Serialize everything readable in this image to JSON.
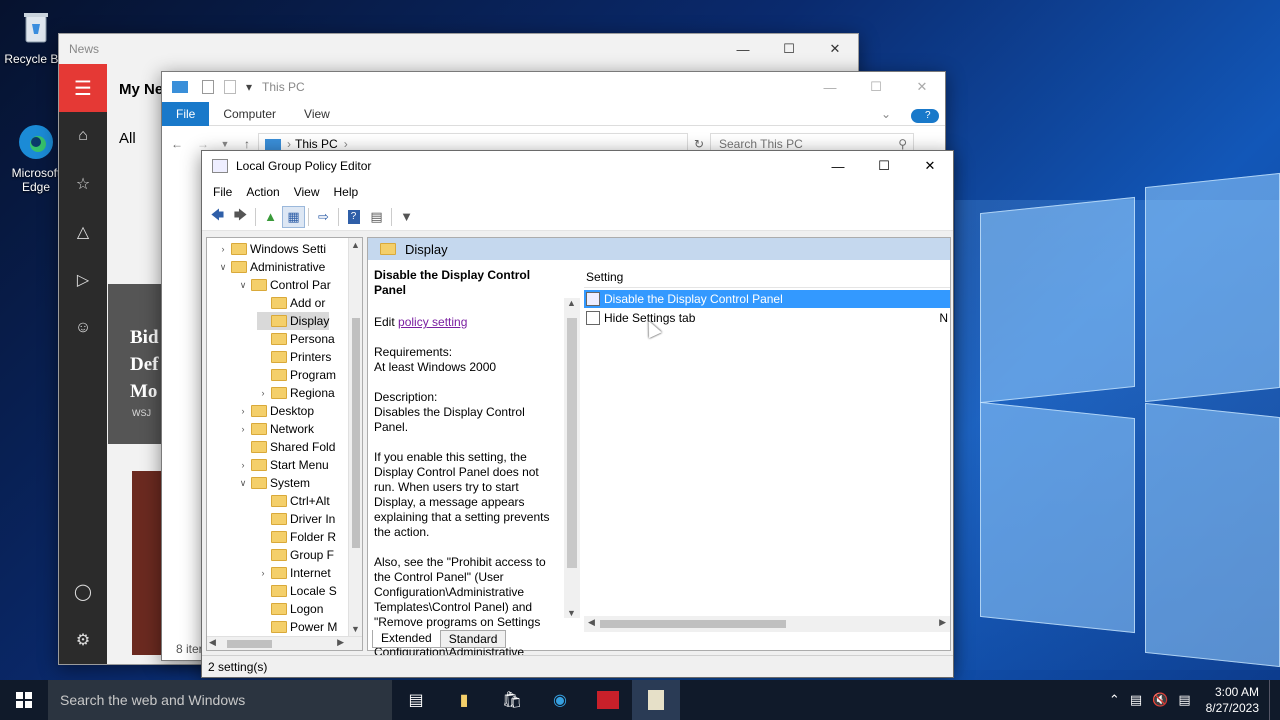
{
  "desktop": {
    "icons": [
      {
        "label": "Recycle Bin"
      },
      {
        "label": "Microsoft Edge"
      }
    ]
  },
  "news": {
    "title": "News",
    "heading": "My Ne",
    "tab_all": "All",
    "headline": "Bid Def Mo",
    "source": "WSJ",
    "items_count": "8 iter"
  },
  "explorer": {
    "title": "This PC",
    "tabs": [
      "File",
      "Computer",
      "View"
    ],
    "address": "This PC",
    "search_placeholder": "Search This PC"
  },
  "gpe": {
    "title": "Local Group Policy Editor",
    "menu": [
      "File",
      "Action",
      "View",
      "Help"
    ],
    "tree": [
      {
        "label": "Windows Setti",
        "level": 1,
        "expander": "collapsed"
      },
      {
        "label": "Administrative",
        "level": 1,
        "expander": "expanded"
      },
      {
        "label": "Control Par",
        "level": 2,
        "expander": "expanded"
      },
      {
        "label": "Add or",
        "level": 3,
        "expander": "none"
      },
      {
        "label": "Display",
        "level": 3,
        "expander": "none",
        "selected": true
      },
      {
        "label": "Persona",
        "level": 3,
        "expander": "none"
      },
      {
        "label": "Printers",
        "level": 3,
        "expander": "none"
      },
      {
        "label": "Program",
        "level": 3,
        "expander": "none"
      },
      {
        "label": "Regiona",
        "level": 3,
        "expander": "collapsed"
      },
      {
        "label": "Desktop",
        "level": 2,
        "expander": "collapsed"
      },
      {
        "label": "Network",
        "level": 2,
        "expander": "collapsed"
      },
      {
        "label": "Shared Fold",
        "level": 2,
        "expander": "none"
      },
      {
        "label": "Start Menu",
        "level": 2,
        "expander": "collapsed"
      },
      {
        "label": "System",
        "level": 2,
        "expander": "expanded"
      },
      {
        "label": "Ctrl+Alt",
        "level": 3,
        "expander": "none"
      },
      {
        "label": "Driver In",
        "level": 3,
        "expander": "none"
      },
      {
        "label": "Folder R",
        "level": 3,
        "expander": "none"
      },
      {
        "label": "Group F",
        "level": 3,
        "expander": "none"
      },
      {
        "label": "Internet",
        "level": 3,
        "expander": "collapsed"
      },
      {
        "label": "Locale S",
        "level": 3,
        "expander": "none"
      },
      {
        "label": "Logon",
        "level": 3,
        "expander": "none"
      },
      {
        "label": "Power M",
        "level": 3,
        "expander": "none"
      }
    ],
    "pane_header": "Display",
    "description": {
      "title": "Disable the Display Control Panel",
      "edit_prefix": "Edit",
      "edit_link": "policy setting",
      "requirements_label": "Requirements:",
      "requirements": "At least Windows 2000",
      "description_label": "Description:",
      "description": "Disables the Display Control Panel.",
      "para1": "If you enable this setting, the Display Control Panel does not run. When users try to start Display, a message appears explaining that a setting prevents the action.",
      "para2": "Also, see the \"Prohibit access to the Control Panel\" (User Configuration\\Administrative Templates\\Control Panel) and \"Remove programs on Settings menu\" (User Configuration\\Administrative"
    },
    "list_header": "Setting",
    "settings": [
      {
        "name": "Disable the Display Control Panel",
        "state": "",
        "selected": true
      },
      {
        "name": "Hide Settings tab",
        "state": "N",
        "selected": false
      }
    ],
    "view_tabs": [
      "Extended",
      "Standard"
    ],
    "status": "2 setting(s)"
  },
  "taskbar": {
    "search_placeholder": "Search the web and Windows",
    "time": "3:00 AM",
    "date": "8/27/2023"
  }
}
